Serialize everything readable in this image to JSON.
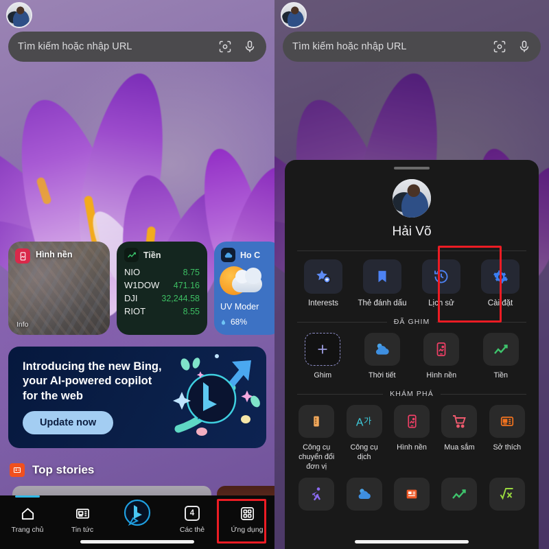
{
  "search": {
    "placeholder": "Tìm kiếm hoặc nhập URL",
    "lens_icon": "lens-scan-icon",
    "mic_icon": "microphone-icon"
  },
  "widgets": {
    "wallpaper": {
      "title": "Hình nền",
      "footer": "Info",
      "icon": "wallpaper-icon"
    },
    "stocks": {
      "title": "Tiền",
      "icon": "chart-up-icon",
      "rows": [
        {
          "symbol": "NIO",
          "value": "8.75"
        },
        {
          "symbol": "W1DOW",
          "value": "471.16"
        },
        {
          "symbol": "DJI",
          "value": "32,244.58"
        },
        {
          "symbol": "RIOT",
          "value": "8.55"
        }
      ]
    },
    "weather": {
      "title": "Ho C",
      "icon": "weather-cloud-icon",
      "uv": "UV Moder",
      "humidity": "68%"
    }
  },
  "promo": {
    "line1": "Introducing the new Bing,",
    "line2": "your AI-powered copilot",
    "line3": "for the web",
    "button": "Update now"
  },
  "stories": {
    "title": "Top stories",
    "icon": "news-icon"
  },
  "bottom_nav": [
    {
      "label": "Trang chủ",
      "icon": "home-icon",
      "active": true
    },
    {
      "label": "Tin tức",
      "icon": "news-icon",
      "active": false
    },
    {
      "label": "",
      "icon": "bing-logo-icon",
      "active": false
    },
    {
      "label": "Các thẻ",
      "icon": "tabs-icon",
      "count": "4",
      "active": false
    },
    {
      "label": "Ứng dụng",
      "icon": "apps-grid-icon",
      "active": false,
      "highlighted": true
    }
  ],
  "panel": {
    "profile_name": "Hải Võ",
    "avatar": "user-avatar",
    "quick_actions": [
      {
        "label": "Interests",
        "icon": "star-plus-icon"
      },
      {
        "label": "Thẻ đánh dấu",
        "icon": "bookmark-icon"
      },
      {
        "label": "Lịch sử",
        "icon": "history-clock-icon"
      },
      {
        "label": "Cài đặt",
        "icon": "gear-icon",
        "highlighted": true
      }
    ],
    "pinned_section": "ĐÃ GHIM",
    "pinned": [
      {
        "label": "Ghim",
        "icon": "plus-icon"
      },
      {
        "label": "Thời tiết",
        "icon": "weather-cloud-icon"
      },
      {
        "label": "Hình nền",
        "icon": "wallpaper-icon"
      },
      {
        "label": "Tiền",
        "icon": "chart-up-icon"
      }
    ],
    "explore_section": "KHÁM PHÁ",
    "explore": [
      {
        "label": "Công cụ chuyển đổi đơn vị",
        "icon": "ruler-icon"
      },
      {
        "label": "Công cụ dịch",
        "icon": "translate-icon"
      },
      {
        "label": "Hình nền",
        "icon": "wallpaper-icon"
      },
      {
        "label": "Mua sắm",
        "icon": "shopping-cart-icon"
      },
      {
        "label": "Sở thích",
        "icon": "news-icon"
      }
    ],
    "explore_row2": [
      {
        "label": "",
        "icon": "running-icon"
      },
      {
        "label": "",
        "icon": "weather-cloud-icon"
      },
      {
        "label": "",
        "icon": "news-icon"
      },
      {
        "label": "",
        "icon": "chart-up-icon"
      },
      {
        "label": "",
        "icon": "math-icon"
      }
    ]
  },
  "colors": {
    "accent_blue": "#2fb8e6",
    "highlight_red": "#ec1c24",
    "stock_green": "#3dbf63",
    "promo_button": "#a3cdf2"
  }
}
